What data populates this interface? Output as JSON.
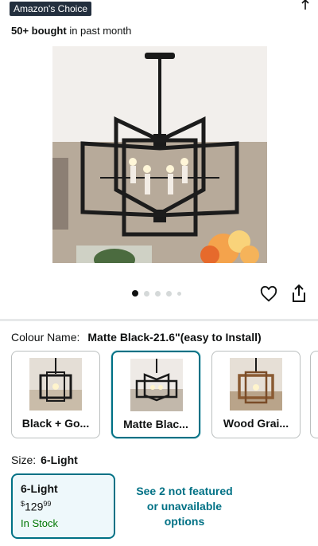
{
  "header": {
    "badge": "Amazon's Choice",
    "bought_bold": "50+ bought",
    "bought_rest": " in past month"
  },
  "gallery": {
    "image_count": 5,
    "active_index": 0
  },
  "colour": {
    "label": "Colour Name:",
    "selected_value": "Matte Black-21.6\"(easy to Install)",
    "options": [
      {
        "label": "Black + Go..."
      },
      {
        "label": "Matte Blac..."
      },
      {
        "label": "Wood Grai..."
      }
    ]
  },
  "size": {
    "label": "Size:",
    "selected_value": "6-Light",
    "option": {
      "name": "6-Light",
      "price_currency": "$",
      "price_whole": "129",
      "price_fraction": "99",
      "stock": "In Stock"
    },
    "see_more_line1": "See 2 not featured",
    "see_more_line2": "or unavailable",
    "see_more_line3": "options"
  },
  "colors": {
    "accent": "#007185",
    "in_stock": "#007600",
    "badge_bg": "#232f3e"
  }
}
